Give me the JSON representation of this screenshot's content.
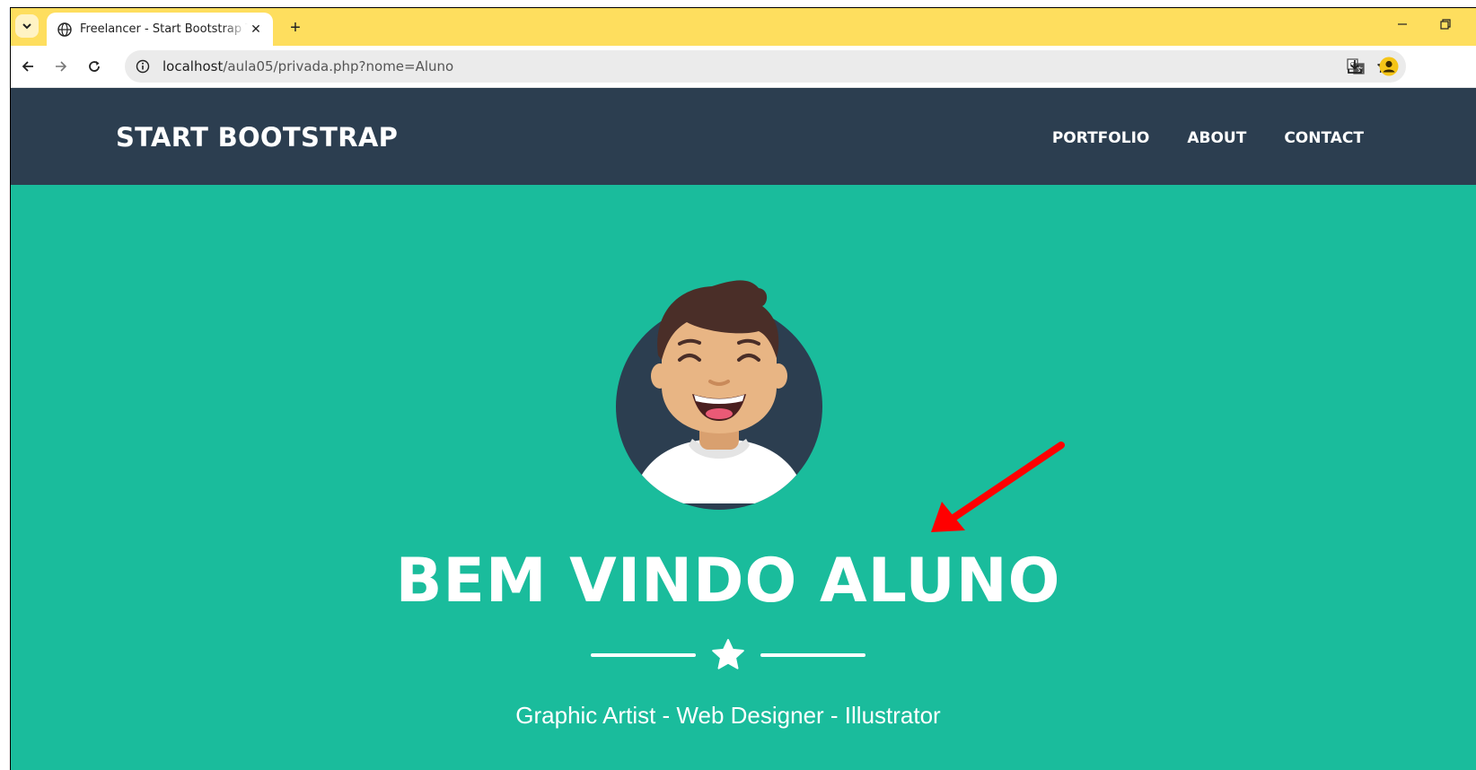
{
  "browser": {
    "tab_title": "Freelancer - Start Bootstrap Theme",
    "tab_close_glyph": "✕",
    "new_tab_glyph": "+",
    "url_host": "localhost",
    "url_path": "/aula05/privada.php?nome=Aluno",
    "icons": [
      "tab-search-icon",
      "globe-icon",
      "close-icon",
      "plus-icon",
      "minimize-icon",
      "restore-icon",
      "back-arrow-icon",
      "forward-arrow-icon",
      "reload-icon",
      "site-info-icon",
      "translate-icon",
      "star-bookmark-icon",
      "download-icon",
      "profile-icon"
    ]
  },
  "site": {
    "brand": "START BOOTSTRAP",
    "nav": [
      {
        "label": "PORTFOLIO"
      },
      {
        "label": "ABOUT"
      },
      {
        "label": "CONTACT"
      }
    ],
    "heading": "BEM VINDO ALUNO",
    "subheading": "Graphic Artist - Web Designer - Illustrator"
  },
  "colors": {
    "tabstrip": "#fede5e",
    "navbar": "#2c3e50",
    "masthead": "#1abc9c",
    "arrow": "#ff0000",
    "text": "#ffffff"
  }
}
